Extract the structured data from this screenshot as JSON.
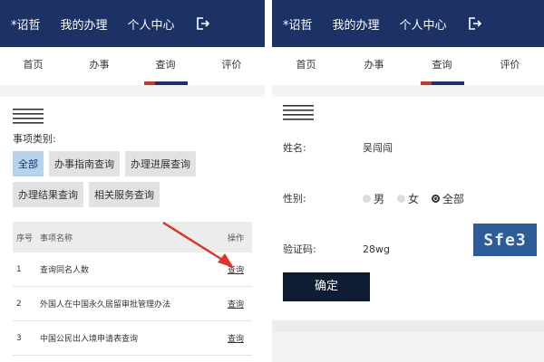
{
  "left": {
    "topbar": {
      "user": "*诏哲",
      "nav_my_tasks": "我的办理",
      "nav_profile": "个人中心"
    },
    "tabs": [
      {
        "label": "首页",
        "active": false
      },
      {
        "label": "办事",
        "active": false
      },
      {
        "label": "查询",
        "active": true
      },
      {
        "label": "评价",
        "active": false
      }
    ],
    "category_label": "事项类别:",
    "categories": [
      {
        "label": "全部",
        "selected": true
      },
      {
        "label": "办事指南查询",
        "selected": false
      },
      {
        "label": "办理进展查询",
        "selected": false
      },
      {
        "label": "办理结果查询",
        "selected": false
      },
      {
        "label": "相关服务查询",
        "selected": false
      }
    ],
    "table": {
      "headers": [
        "序号",
        "事项名称",
        "操作"
      ],
      "rows": [
        {
          "no": "1",
          "name": "查询同名人数",
          "action": "查询"
        },
        {
          "no": "2",
          "name": "外国人在中国永久居留审批管理办法",
          "action": "查询"
        },
        {
          "no": "3",
          "name": "中国公民出入境申请表查询",
          "action": "查询"
        }
      ]
    }
  },
  "right": {
    "topbar": {
      "user": "*诏哲",
      "nav_my_tasks": "我的办理",
      "nav_profile": "个人中心"
    },
    "tabs": [
      {
        "label": "首页",
        "active": false
      },
      {
        "label": "办事",
        "active": false
      },
      {
        "label": "查询",
        "active": true
      },
      {
        "label": "评价",
        "active": false
      }
    ],
    "form": {
      "name_label": "姓名:",
      "name_value": "吴闯闯",
      "gender_label": "性别:",
      "gender_options": [
        {
          "label": "男",
          "checked": false
        },
        {
          "label": "女",
          "checked": false
        },
        {
          "label": "全部",
          "checked": true
        }
      ],
      "captcha_label": "验证码:",
      "captcha_value": "28wg",
      "captcha_image_text": "Sfe3",
      "submit_label": "确定"
    }
  },
  "colors": {
    "header": "#1c3164",
    "accent_red": "#c0392b",
    "chip_selected": "#b7d2ee",
    "button": "#0e1d33"
  }
}
